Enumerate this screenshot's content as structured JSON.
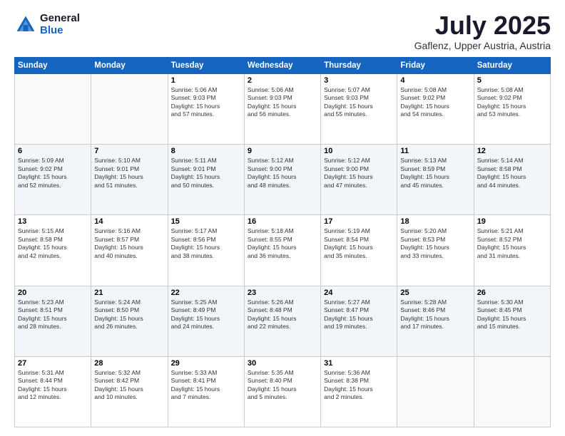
{
  "logo": {
    "line1": "General",
    "line2": "Blue"
  },
  "title": "July 2025",
  "subtitle": "Gaflenz, Upper Austria, Austria",
  "days_header": [
    "Sunday",
    "Monday",
    "Tuesday",
    "Wednesday",
    "Thursday",
    "Friday",
    "Saturday"
  ],
  "weeks": [
    {
      "alt": false,
      "cells": [
        {
          "day": "",
          "info": ""
        },
        {
          "day": "",
          "info": ""
        },
        {
          "day": "1",
          "info": "Sunrise: 5:06 AM\nSunset: 9:03 PM\nDaylight: 15 hours\nand 57 minutes."
        },
        {
          "day": "2",
          "info": "Sunrise: 5:06 AM\nSunset: 9:03 PM\nDaylight: 15 hours\nand 56 minutes."
        },
        {
          "day": "3",
          "info": "Sunrise: 5:07 AM\nSunset: 9:03 PM\nDaylight: 15 hours\nand 55 minutes."
        },
        {
          "day": "4",
          "info": "Sunrise: 5:08 AM\nSunset: 9:02 PM\nDaylight: 15 hours\nand 54 minutes."
        },
        {
          "day": "5",
          "info": "Sunrise: 5:08 AM\nSunset: 9:02 PM\nDaylight: 15 hours\nand 53 minutes."
        }
      ]
    },
    {
      "alt": true,
      "cells": [
        {
          "day": "6",
          "info": "Sunrise: 5:09 AM\nSunset: 9:02 PM\nDaylight: 15 hours\nand 52 minutes."
        },
        {
          "day": "7",
          "info": "Sunrise: 5:10 AM\nSunset: 9:01 PM\nDaylight: 15 hours\nand 51 minutes."
        },
        {
          "day": "8",
          "info": "Sunrise: 5:11 AM\nSunset: 9:01 PM\nDaylight: 15 hours\nand 50 minutes."
        },
        {
          "day": "9",
          "info": "Sunrise: 5:12 AM\nSunset: 9:00 PM\nDaylight: 15 hours\nand 48 minutes."
        },
        {
          "day": "10",
          "info": "Sunrise: 5:12 AM\nSunset: 9:00 PM\nDaylight: 15 hours\nand 47 minutes."
        },
        {
          "day": "11",
          "info": "Sunrise: 5:13 AM\nSunset: 8:59 PM\nDaylight: 15 hours\nand 45 minutes."
        },
        {
          "day": "12",
          "info": "Sunrise: 5:14 AM\nSunset: 8:58 PM\nDaylight: 15 hours\nand 44 minutes."
        }
      ]
    },
    {
      "alt": false,
      "cells": [
        {
          "day": "13",
          "info": "Sunrise: 5:15 AM\nSunset: 8:58 PM\nDaylight: 15 hours\nand 42 minutes."
        },
        {
          "day": "14",
          "info": "Sunrise: 5:16 AM\nSunset: 8:57 PM\nDaylight: 15 hours\nand 40 minutes."
        },
        {
          "day": "15",
          "info": "Sunrise: 5:17 AM\nSunset: 8:56 PM\nDaylight: 15 hours\nand 38 minutes."
        },
        {
          "day": "16",
          "info": "Sunrise: 5:18 AM\nSunset: 8:55 PM\nDaylight: 15 hours\nand 36 minutes."
        },
        {
          "day": "17",
          "info": "Sunrise: 5:19 AM\nSunset: 8:54 PM\nDaylight: 15 hours\nand 35 minutes."
        },
        {
          "day": "18",
          "info": "Sunrise: 5:20 AM\nSunset: 8:53 PM\nDaylight: 15 hours\nand 33 minutes."
        },
        {
          "day": "19",
          "info": "Sunrise: 5:21 AM\nSunset: 8:52 PM\nDaylight: 15 hours\nand 31 minutes."
        }
      ]
    },
    {
      "alt": true,
      "cells": [
        {
          "day": "20",
          "info": "Sunrise: 5:23 AM\nSunset: 8:51 PM\nDaylight: 15 hours\nand 28 minutes."
        },
        {
          "day": "21",
          "info": "Sunrise: 5:24 AM\nSunset: 8:50 PM\nDaylight: 15 hours\nand 26 minutes."
        },
        {
          "day": "22",
          "info": "Sunrise: 5:25 AM\nSunset: 8:49 PM\nDaylight: 15 hours\nand 24 minutes."
        },
        {
          "day": "23",
          "info": "Sunrise: 5:26 AM\nSunset: 8:48 PM\nDaylight: 15 hours\nand 22 minutes."
        },
        {
          "day": "24",
          "info": "Sunrise: 5:27 AM\nSunset: 8:47 PM\nDaylight: 15 hours\nand 19 minutes."
        },
        {
          "day": "25",
          "info": "Sunrise: 5:28 AM\nSunset: 8:46 PM\nDaylight: 15 hours\nand 17 minutes."
        },
        {
          "day": "26",
          "info": "Sunrise: 5:30 AM\nSunset: 8:45 PM\nDaylight: 15 hours\nand 15 minutes."
        }
      ]
    },
    {
      "alt": false,
      "cells": [
        {
          "day": "27",
          "info": "Sunrise: 5:31 AM\nSunset: 8:44 PM\nDaylight: 15 hours\nand 12 minutes."
        },
        {
          "day": "28",
          "info": "Sunrise: 5:32 AM\nSunset: 8:42 PM\nDaylight: 15 hours\nand 10 minutes."
        },
        {
          "day": "29",
          "info": "Sunrise: 5:33 AM\nSunset: 8:41 PM\nDaylight: 15 hours\nand 7 minutes."
        },
        {
          "day": "30",
          "info": "Sunrise: 5:35 AM\nSunset: 8:40 PM\nDaylight: 15 hours\nand 5 minutes."
        },
        {
          "day": "31",
          "info": "Sunrise: 5:36 AM\nSunset: 8:38 PM\nDaylight: 15 hours\nand 2 minutes."
        },
        {
          "day": "",
          "info": ""
        },
        {
          "day": "",
          "info": ""
        }
      ]
    }
  ]
}
